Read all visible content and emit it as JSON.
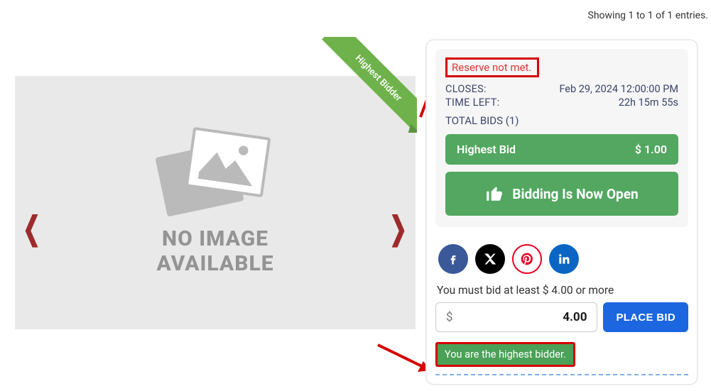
{
  "entries_text": "Showing 1 to 1 of 1 entries.",
  "ribbon_label": "Highest Bidder",
  "image": {
    "noimage_line1": "NO IMAGE",
    "noimage_line2": "AVAILABLE"
  },
  "bid_panel": {
    "reserve_text": "Reserve not met.",
    "closes_label": "CLOSES:",
    "closes_value": "Feb 29, 2024 12:00:00 PM",
    "timeleft_label": "TIME LEFT:",
    "timeleft_value": "22h 15m 55s",
    "totalbids_text": "TOTAL BIDS (1)",
    "highest_bid_label": "Highest Bid",
    "highest_bid_value": "$ 1.00",
    "bidding_open_text": "Bidding Is Now Open",
    "min_bid_hint": "You must bid at least $ 4.00 or more",
    "currency_symbol": "$",
    "current_input_value": "4.00",
    "place_bid_label": "PLACE BID",
    "highest_bidder_text": "You are the highest bidder."
  }
}
